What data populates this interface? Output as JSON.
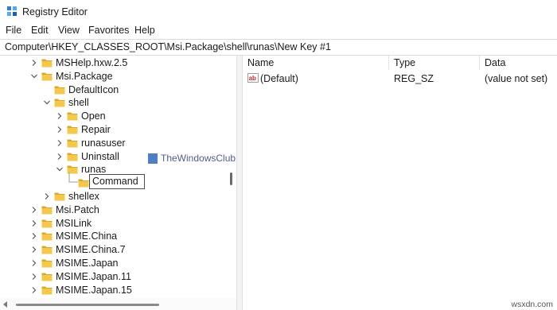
{
  "window": {
    "title": "Registry Editor",
    "icon": "registry-editor-icon"
  },
  "menu": [
    "File",
    "Edit",
    "View",
    "Favorites",
    "Help"
  ],
  "address": "Computer\\HKEY_CLASSES_ROOT\\Msi.Package\\shell\\runas\\New Key #1",
  "tree": [
    {
      "label": "MSHelp.hxw.2.5",
      "level": 2,
      "expander": "collapsed"
    },
    {
      "label": "Msi.Package",
      "level": 2,
      "expander": "expanded"
    },
    {
      "label": "DefaultIcon",
      "level": 3,
      "expander": "none"
    },
    {
      "label": "shell",
      "level": 3,
      "expander": "expanded"
    },
    {
      "label": "Open",
      "level": 4,
      "expander": "collapsed"
    },
    {
      "label": "Repair",
      "level": 4,
      "expander": "collapsed"
    },
    {
      "label": "runasuser",
      "level": 4,
      "expander": "collapsed"
    },
    {
      "label": "Uninstall",
      "level": 4,
      "expander": "collapsed"
    },
    {
      "label": "runas",
      "level": 4,
      "expander": "expanded"
    },
    {
      "label": "",
      "level": 5,
      "expander": "none"
    },
    {
      "label": "shellex",
      "level": 3,
      "expander": "collapsed"
    },
    {
      "label": "Msi.Patch",
      "level": 2,
      "expander": "collapsed"
    },
    {
      "label": "MSILink",
      "level": 2,
      "expander": "collapsed"
    },
    {
      "label": "MSIME.China",
      "level": 2,
      "expander": "collapsed"
    },
    {
      "label": "MSIME.China.7",
      "level": 2,
      "expander": "collapsed"
    },
    {
      "label": "MSIME.Japan",
      "level": 2,
      "expander": "collapsed"
    },
    {
      "label": "MSIME.Japan.11",
      "level": 2,
      "expander": "collapsed"
    },
    {
      "label": "MSIME.Japan.15",
      "level": 2,
      "expander": "collapsed"
    }
  ],
  "rename": {
    "value": "Command"
  },
  "list": {
    "columns": [
      "Name",
      "Type",
      "Data"
    ],
    "rows": [
      {
        "name": "(Default)",
        "type": "REG_SZ",
        "data": "(value not set)",
        "icon": "string-value-icon"
      }
    ]
  },
  "watermark": {
    "text": "TheWindowsClub"
  },
  "credit": "wsxdn.com",
  "colors": {
    "folder": "#f2c94c",
    "folder_edge": "#d9a72a",
    "chevron": "#555555",
    "string_icon": "#c62828"
  }
}
